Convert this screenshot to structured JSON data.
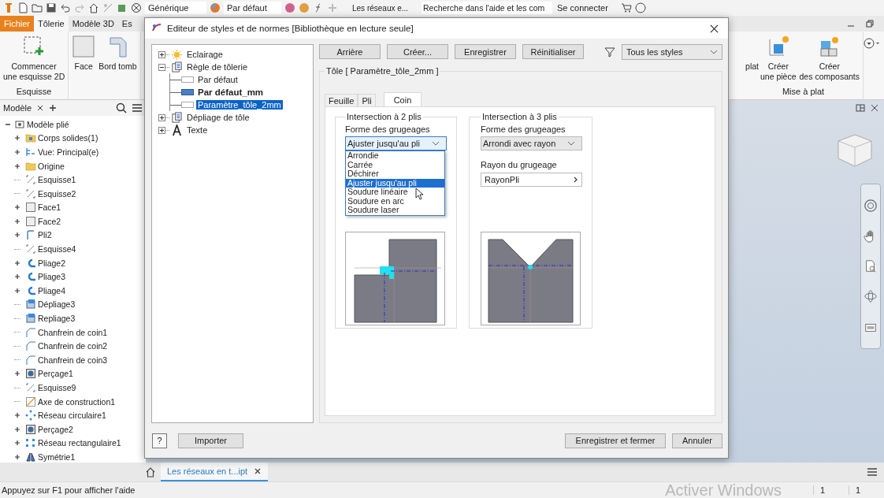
{
  "quick_access": {
    "style_dropdown": "Générique",
    "appearance_dropdown": "Par défaut",
    "document": "Les réseaux e...",
    "search": {
      "placeholder": "Recherche dans l'aide et les com"
    },
    "sign_in": "Se connecter"
  },
  "ribbon_tabs": [
    {
      "label": "Fichier",
      "kind": "file",
      "selected": false
    },
    {
      "label": "Tôlerie",
      "kind": "tab",
      "selected": true
    },
    {
      "label": "Modèle 3D",
      "kind": "tab",
      "selected": false
    },
    {
      "label": "Es",
      "kind": "tab",
      "selected": false
    }
  ],
  "ribbon_left": [
    {
      "label": "Esquisse",
      "tools": [
        {
          "lines": [
            "Commencer",
            "une esquisse 2D"
          ],
          "kind": "sketch"
        }
      ]
    },
    {
      "tools": [
        {
          "lines": [
            "Face"
          ],
          "kind": "face"
        },
        {
          "lines": [
            "Bord tomb"
          ],
          "kind": "flange"
        }
      ]
    }
  ],
  "ribbon_right": [
    {
      "label": "Mise à plat",
      "tools": [
        {
          "lines": [
            "plat"
          ],
          "kind": "hidden"
        },
        {
          "lines": [
            "Créer",
            "une pièce"
          ],
          "kind": "part"
        },
        {
          "lines": [
            "Créer",
            "des composants"
          ],
          "kind": "components"
        }
      ]
    }
  ],
  "browser": {
    "tab": "Modèle",
    "root": {
      "label": "Modèle plié",
      "kind": "assembly",
      "expanded": true,
      "children": [
        {
          "label": "Corps solides(1)",
          "kind": "solids",
          "expandable": true
        },
        {
          "label": "Vue: Principal(e)",
          "kind": "view",
          "expandable": true
        },
        {
          "label": "Origine",
          "kind": "folder",
          "expandable": true
        },
        {
          "label": "Esquisse1",
          "kind": "sketch",
          "expandable": false
        },
        {
          "label": "Esquisse2",
          "kind": "sketch",
          "expandable": false
        },
        {
          "label": "Face1",
          "kind": "face",
          "expandable": true
        },
        {
          "label": "Face2",
          "kind": "face",
          "expandable": true
        },
        {
          "label": "Pli2",
          "kind": "flange",
          "expandable": true
        },
        {
          "label": "Esquisse4",
          "kind": "sketch",
          "expandable": false
        },
        {
          "label": "Pliage2",
          "kind": "fold",
          "expandable": true
        },
        {
          "label": "Pliage3",
          "kind": "fold",
          "expandable": true
        },
        {
          "label": "Pliage4",
          "kind": "fold",
          "expandable": true
        },
        {
          "label": "Dépliage3",
          "kind": "unfold",
          "expandable": false
        },
        {
          "label": "Repliage3",
          "kind": "refold",
          "expandable": false
        },
        {
          "label": "Chanfrein de coin1",
          "kind": "chamfer",
          "expandable": false
        },
        {
          "label": "Chanfrein de coin2",
          "kind": "chamfer",
          "expandable": false
        },
        {
          "label": "Chanfrein de coin3",
          "kind": "chamfer",
          "expandable": false
        },
        {
          "label": "Perçage1",
          "kind": "hole",
          "expandable": true
        },
        {
          "label": "Esquisse9",
          "kind": "sketch",
          "expandable": false
        },
        {
          "label": "Axe de construction1",
          "kind": "axis",
          "expandable": false
        },
        {
          "label": "Réseau circulaire1",
          "kind": "circular-pattern",
          "expandable": true
        },
        {
          "label": "Perçage2",
          "kind": "hole",
          "expandable": true
        },
        {
          "label": "Réseau rectangulaire1",
          "kind": "rectangular-pattern",
          "expandable": true
        },
        {
          "label": "Symétrie1",
          "kind": "mirror",
          "expandable": true
        }
      ]
    }
  },
  "dialog": {
    "title": "Editeur de styles et de normes [Bibliothèque en lecture seule]",
    "tree": [
      {
        "label": "Eclairage",
        "kind": "light",
        "expanded": false
      },
      {
        "label": "Règle de tôlerie",
        "kind": "rule",
        "expanded": true,
        "children": [
          {
            "label": "Par défaut",
            "active": false,
            "selected": false
          },
          {
            "label": "Par défaut_mm",
            "active": true,
            "selected": false
          },
          {
            "label": "Paramètre_tôle_2mm",
            "active": false,
            "selected": true
          }
        ]
      },
      {
        "label": "Dépliage de tôle",
        "kind": "rule",
        "expanded": false
      },
      {
        "label": "Texte",
        "kind": "text",
        "expanded": false
      }
    ],
    "buttons": [
      "Arrière",
      "Créer...",
      "Enregistrer",
      "Réinitialiser"
    ],
    "filter": "Tous les styles",
    "style_group": "Tôle [ Paramètre_tôle_2mm ]",
    "tabs": [
      {
        "label": "Feuille",
        "selected": false
      },
      {
        "label": "Pli",
        "selected": false
      },
      {
        "label": "Coin",
        "selected": true
      }
    ],
    "intersections": [
      {
        "title": "Intersection à 2 plis",
        "shape_label": "Forme des grugeages",
        "shape_value": "Ajuster jusqu'au pli",
        "open": true,
        "kind": "fit",
        "options": [
          {
            "label": "Arrondie",
            "selected": false
          },
          {
            "label": "Carrée",
            "selected": false
          },
          {
            "label": "Déchirer",
            "selected": false
          },
          {
            "label": "Ajuster jusqu'au pli",
            "selected": true
          },
          {
            "label": "Soudure linéaire",
            "selected": false
          },
          {
            "label": "Soudure en arc",
            "selected": false
          },
          {
            "label": "Soudure laser",
            "selected": false
          }
        ]
      },
      {
        "title": "Intersection à 3 plis",
        "shape_label": "Forme des grugeages",
        "shape_value": "Arrondi avec rayon",
        "open": false,
        "kind": "round",
        "radius_label": "Rayon du grugeage",
        "radius_value": "RayonPli"
      }
    ],
    "help": "?",
    "import": "Importer",
    "save_close": "Enregistrer et fermer",
    "cancel": "Annuler"
  },
  "document_tab": "Les réseaux en t...ipt",
  "status_bar": {
    "hint": "Appuyez sur F1 pour afficher l'aide",
    "activation": "Activer Windows",
    "cells": [
      "1",
      "1"
    ]
  }
}
